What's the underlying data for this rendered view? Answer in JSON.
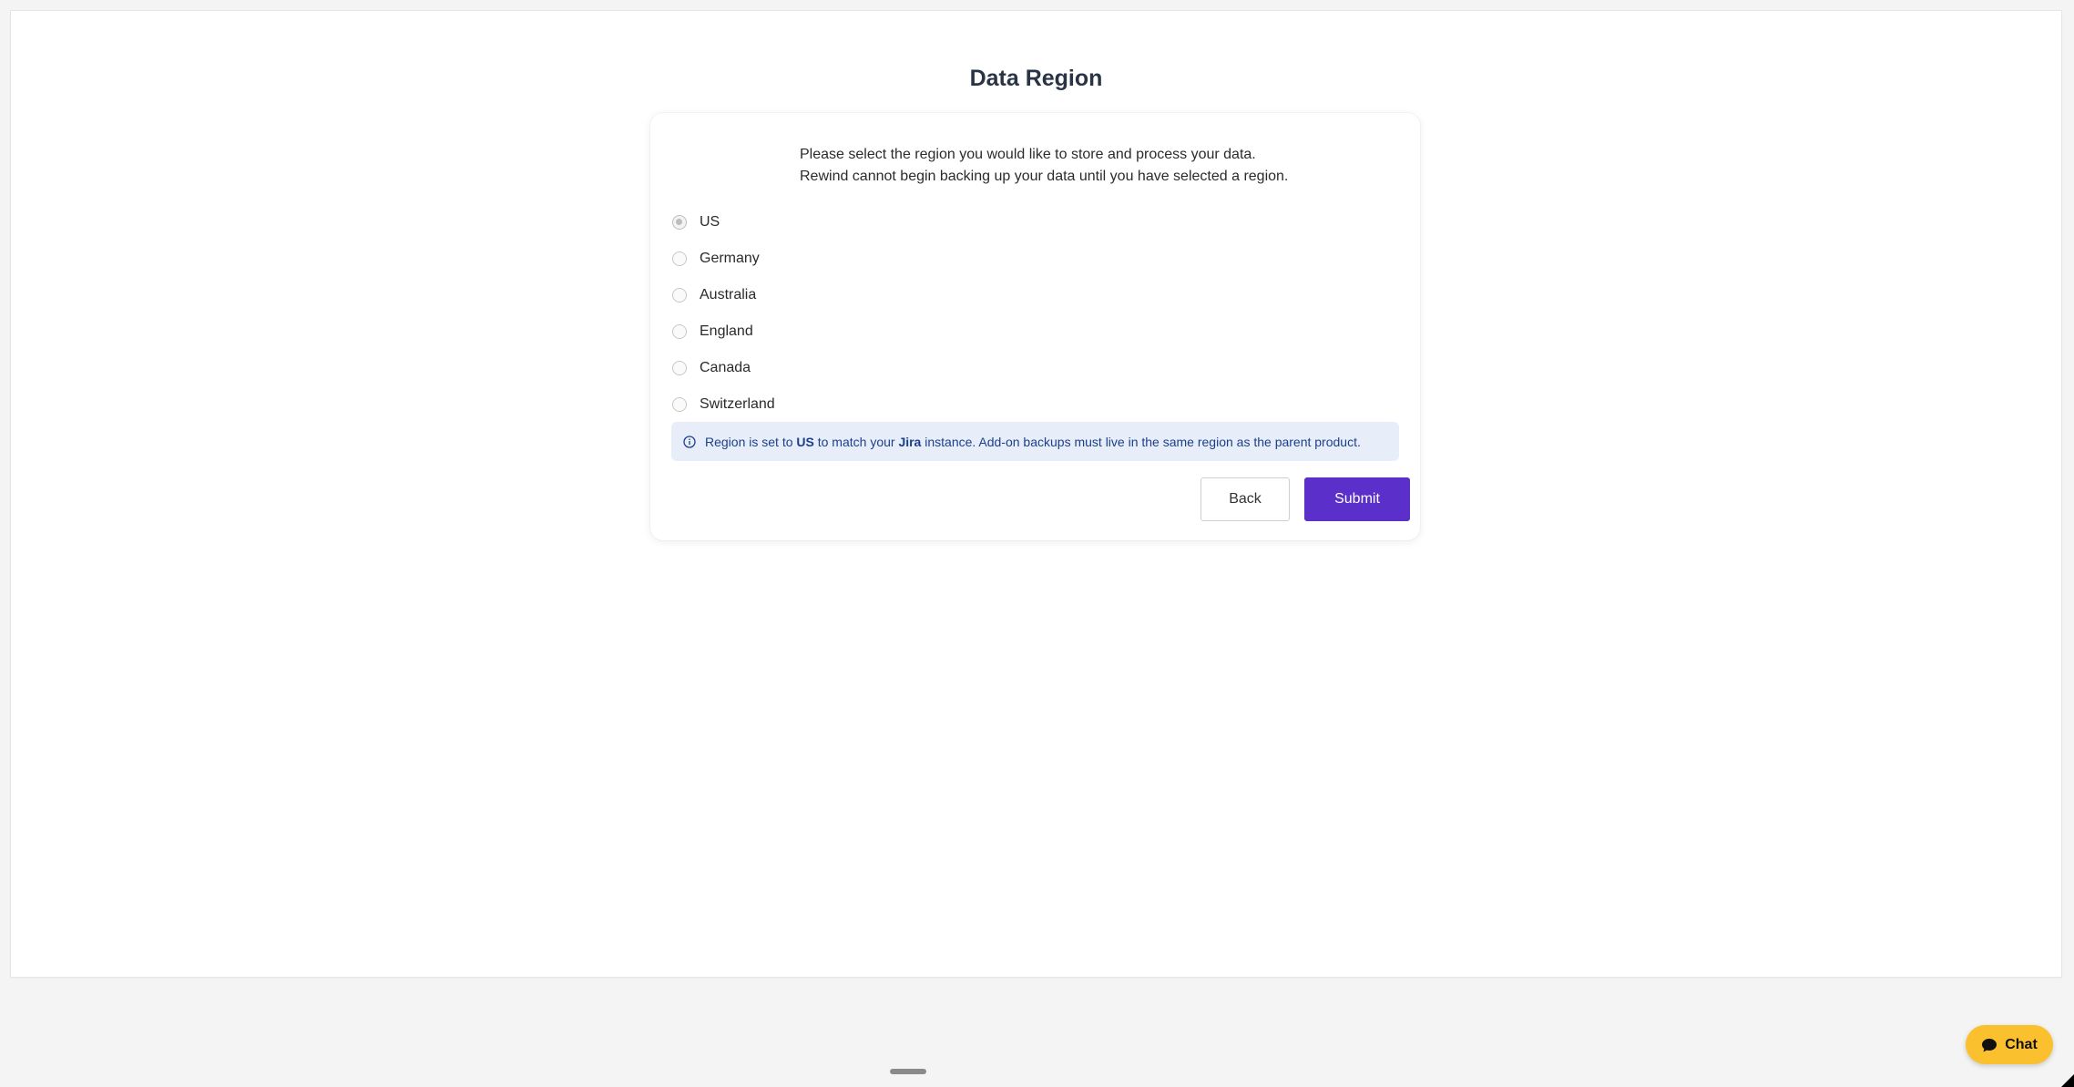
{
  "page": {
    "title": "Data Region"
  },
  "card": {
    "intro_line1": "Please select the region you would like to store and process your data.",
    "intro_line2": "Rewind cannot begin backing up your data until you have selected a region.",
    "regions": [
      {
        "label": "US",
        "selected": true
      },
      {
        "label": "Germany",
        "selected": false
      },
      {
        "label": "Australia",
        "selected": false
      },
      {
        "label": "England",
        "selected": false
      },
      {
        "label": "Canada",
        "selected": false
      },
      {
        "label": "Switzerland",
        "selected": false
      }
    ],
    "info": {
      "icon": "info-circle-icon",
      "text_before": "Region is set to ",
      "region": "US",
      "text_middle": " to match your ",
      "product": "Jira",
      "text_after": " instance. Add-on backups must live in the same region as the parent product."
    },
    "back_label": "Back",
    "submit_label": "Submit"
  },
  "chat": {
    "label": "Chat",
    "icon": "chat-bubble-icon"
  },
  "colors": {
    "primary": "#5b2fc9",
    "info_bg": "#e7eef9",
    "info_text": "#1d3f8a",
    "chat_bg": "#fbc02d"
  }
}
